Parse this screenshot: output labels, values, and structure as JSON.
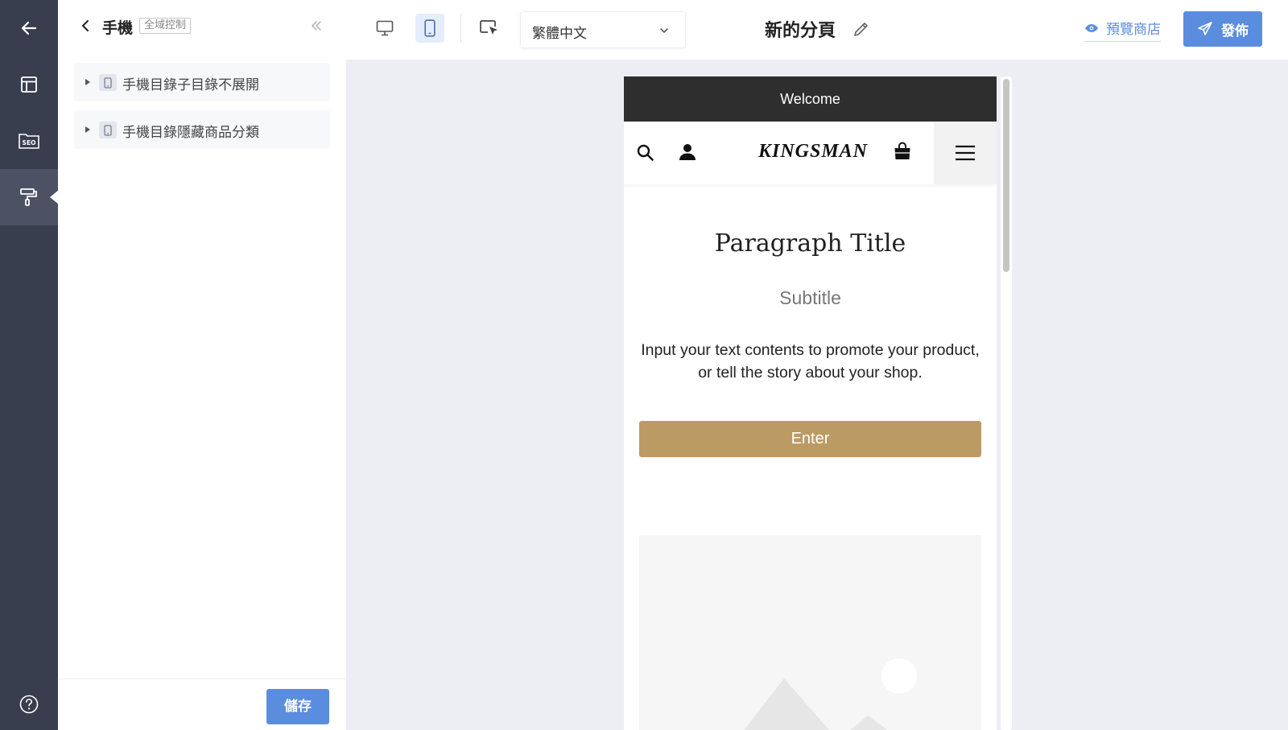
{
  "sidebar_rail": {
    "items": [
      {
        "icon": "back-arrow-icon"
      },
      {
        "icon": "layout-icon"
      },
      {
        "icon": "seo-folder-icon",
        "text": "SEO"
      },
      {
        "icon": "paint-roller-icon"
      },
      {
        "icon": "help-icon"
      }
    ],
    "active_index": 3
  },
  "panel": {
    "title": "手機",
    "badge": "全域控制",
    "items": [
      {
        "label": "手機目錄子目錄不展開",
        "icon": "mobile-icon"
      },
      {
        "label": "手機目錄隱藏商品分類",
        "icon": "mobile-icon"
      }
    ],
    "save_label": "儲存"
  },
  "toolbar": {
    "device_desktop_icon": "desktop-icon",
    "device_mobile_icon": "mobile-icon",
    "active_device": "mobile",
    "select_tool_icon": "cursor-select-icon",
    "language_value": "繁體中文",
    "page_name": "新的分頁",
    "preview_label": "預覽商店",
    "publish_label": "發佈"
  },
  "preview": {
    "welcome_text": "Welcome",
    "logo_text": "KINGSMAN",
    "paragraph_title": "Paragraph Title",
    "subtitle": "Subtitle",
    "body_text": "Input your text contents to promote your product, or tell the story about your shop.",
    "button_label": "Enter"
  },
  "colors": {
    "rail_bg": "#383e4d",
    "accent_blue": "#5b8dde",
    "canvas_bg": "#eceef3",
    "welcome_bar": "#2e2e2e",
    "enter_button": "#bb9a63"
  }
}
